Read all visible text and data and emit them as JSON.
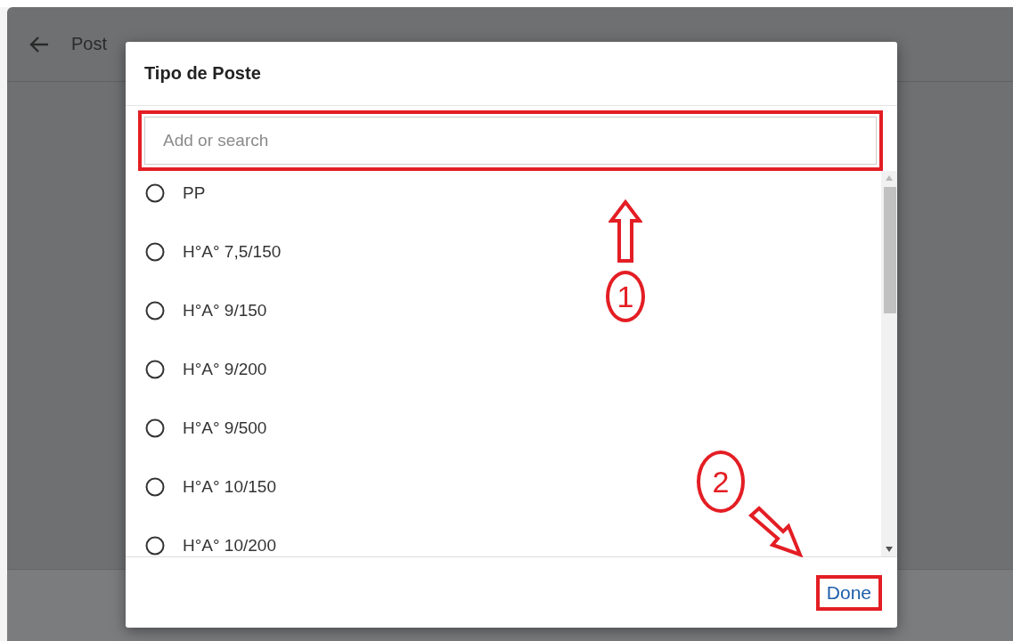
{
  "app_bar": {
    "title": "Post"
  },
  "dialog": {
    "title": "Tipo de Poste",
    "search": {
      "placeholder": "Add or search"
    },
    "options": [
      {
        "label": "PP",
        "selected": false
      },
      {
        "label": "H°A° 7,5/150",
        "selected": false
      },
      {
        "label": "H°A° 9/150",
        "selected": false
      },
      {
        "label": "H°A° 9/200",
        "selected": false
      },
      {
        "label": "H°A° 9/500",
        "selected": false
      },
      {
        "label": "H°A° 10/150",
        "selected": false
      },
      {
        "label": "H°A° 10/200",
        "selected": false
      }
    ],
    "done_button": "Done"
  },
  "annotations": [
    {
      "label": "1"
    },
    {
      "label": "2"
    }
  ]
}
